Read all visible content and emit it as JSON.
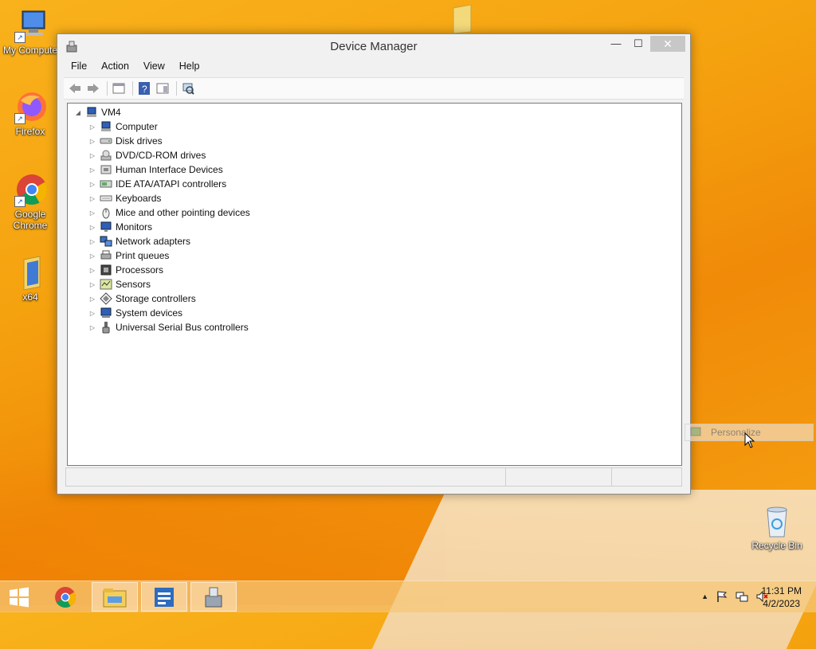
{
  "desktop": {
    "icons": [
      {
        "label": "My Compute"
      },
      {
        "label": "Firefox"
      },
      {
        "label": "Google Chrome"
      },
      {
        "label": "x64"
      },
      {
        "label": "Recycle Bin"
      }
    ]
  },
  "window": {
    "title": "Device Manager",
    "controls": {
      "minimize": "—",
      "maximize": "☐",
      "close": "✕"
    },
    "menu": [
      "File",
      "Action",
      "View",
      "Help"
    ],
    "toolbar_icons": [
      "back-icon",
      "forward-icon",
      "properties-view-icon",
      "help-icon",
      "show-hide-console-icon",
      "scan-hardware-icon"
    ],
    "tree": {
      "root": {
        "label": "VM4",
        "expanded": true
      },
      "categories": [
        {
          "label": "Computer",
          "icon": "computer-icon"
        },
        {
          "label": "Disk drives",
          "icon": "disk-drive-icon"
        },
        {
          "label": "DVD/CD-ROM drives",
          "icon": "dvd-icon"
        },
        {
          "label": "Human Interface Devices",
          "icon": "hid-icon"
        },
        {
          "label": "IDE ATA/ATAPI controllers",
          "icon": "ide-controller-icon"
        },
        {
          "label": "Keyboards",
          "icon": "keyboard-icon"
        },
        {
          "label": "Mice and other pointing devices",
          "icon": "mouse-icon"
        },
        {
          "label": "Monitors",
          "icon": "monitor-icon"
        },
        {
          "label": "Network adapters",
          "icon": "network-adapter-icon"
        },
        {
          "label": "Print queues",
          "icon": "printer-icon"
        },
        {
          "label": "Processors",
          "icon": "processor-icon"
        },
        {
          "label": "Sensors",
          "icon": "sensor-icon"
        },
        {
          "label": "Storage controllers",
          "icon": "storage-controller-icon"
        },
        {
          "label": "System devices",
          "icon": "system-device-icon"
        },
        {
          "label": "Universal Serial Bus controllers",
          "icon": "usb-icon"
        }
      ]
    }
  },
  "context_menu": {
    "item": "Personalize"
  },
  "taskbar": {
    "buttons": [
      "start-button",
      "chrome-taskbar-button",
      "file-explorer-taskbar-button",
      "server-manager-taskbar-button",
      "device-manager-taskbar-button"
    ],
    "clock": {
      "time": "11:31 PM",
      "date": "4/2/2023"
    }
  },
  "colors": {
    "accent": "#f5a20f",
    "close_button": "#c7c7c7"
  }
}
